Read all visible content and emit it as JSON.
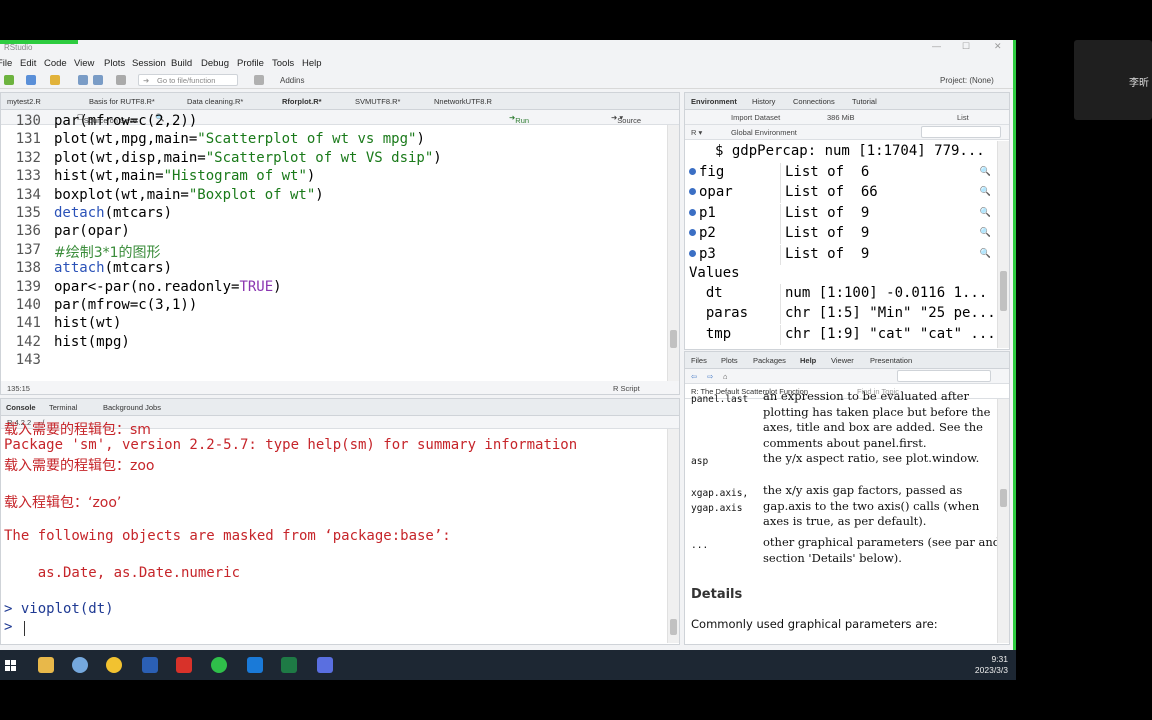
{
  "window": {
    "title": "RStudio"
  },
  "participant": {
    "name": "李昕"
  },
  "menu": [
    "File",
    "Edit",
    "Code",
    "View",
    "Plots",
    "Session",
    "Build",
    "Debug",
    "Profile",
    "Tools",
    "Help"
  ],
  "toolbar": {
    "goto_placeholder": "Go to file/function",
    "addins": "Addins",
    "project": "Project: (None)"
  },
  "editor": {
    "tabs": [
      "mytest2.R",
      "Basis for RUTF8.R*",
      "Data cleaning.R*",
      "Rforplot.R*",
      "SVMUTF8.R*",
      "NnetworkUTF8.R"
    ],
    "source_on_save": "Source on Save",
    "run": "Run",
    "source": "Source",
    "lines": [
      {
        "n": "130",
        "code": "par(mfrow=c(2,2))"
      },
      {
        "n": "131",
        "code": "plot(wt,mpg,main=\"Scatterplot of wt vs mpg\")"
      },
      {
        "n": "132",
        "code": "plot(wt,disp,main=\"Scatterplot of wt VS dsip\")"
      },
      {
        "n": "133",
        "code": "hist(wt,main=\"Histogram of wt\")"
      },
      {
        "n": "134",
        "code": "boxplot(wt,main=\"Boxplot of wt\")"
      },
      {
        "n": "135",
        "code": "detach(mtcars)"
      },
      {
        "n": "136",
        "code": "par(opar)"
      },
      {
        "n": "137",
        "code": "#绘制3*1的图形"
      },
      {
        "n": "138",
        "code": "attach(mtcars)"
      },
      {
        "n": "139",
        "code": "opar<-par(no.readonly=TRUE)"
      },
      {
        "n": "140",
        "code": "par(mfrow=c(3,1))"
      },
      {
        "n": "141",
        "code": "hist(wt)"
      },
      {
        "n": "142",
        "code": "hist(mpg)"
      },
      {
        "n": "143",
        "code": ""
      }
    ],
    "status_pos": "135:15",
    "status_lang": "R Script"
  },
  "console": {
    "tabs": [
      "Console",
      "Terminal",
      "Background Jobs"
    ],
    "version": "R 4.2.2 · ~/",
    "lines": [
      {
        "text": "载入需要的程辑包：sm",
        "cls": "red cjk"
      },
      {
        "text": "Package 'sm', version 2.2-5.7: type help(sm) for summary information",
        "cls": "red"
      },
      {
        "text": "载入需要的程辑包：zoo",
        "cls": "red cjk"
      },
      {
        "text": "",
        "cls": "red"
      },
      {
        "text": "载入程辑包：‘zoo’",
        "cls": "red cjk"
      },
      {
        "text": "",
        "cls": "red"
      },
      {
        "text": "The following objects are masked from ‘package:base’:",
        "cls": "red"
      },
      {
        "text": "",
        "cls": "red"
      },
      {
        "text": "    as.Date, as.Date.numeric",
        "cls": "red"
      },
      {
        "text": "",
        "cls": "red"
      },
      {
        "text": "> vioplot(dt)",
        "cls": "blue"
      },
      {
        "text": "> ",
        "cls": "blue"
      }
    ]
  },
  "environment": {
    "tabs": [
      "Environment",
      "History",
      "Connections",
      "Tutorial"
    ],
    "import_dataset": "Import Dataset",
    "memory": "386 MiB",
    "list_view": "List",
    "global_env": "Global Environment",
    "top_row": "$ gdpPercap: num [1:1704] 779...",
    "data_rows": [
      {
        "name": "fig",
        "value": "List of  6"
      },
      {
        "name": "opar",
        "value": "List of  66"
      },
      {
        "name": "p1",
        "value": "List of  9"
      },
      {
        "name": "p2",
        "value": "List of  9"
      },
      {
        "name": "p3",
        "value": "List of  9"
      }
    ],
    "values_header": "Values",
    "value_rows": [
      {
        "name": "dt",
        "value": "num [1:100] -0.0116 1..."
      },
      {
        "name": "paras",
        "value": "chr [1:5] \"Min\" \"25 pe..."
      },
      {
        "name": "tmp",
        "value": "chr [1:9] \"cat\" \"cat\" ..."
      }
    ]
  },
  "help": {
    "tabs": [
      "Files",
      "Plots",
      "Packages",
      "Help",
      "Viewer",
      "Presentation"
    ],
    "topic": "R: The Default Scatterplot Function",
    "find_placeholder": "Find in Topic",
    "rows": [
      {
        "term": "panel.last",
        "desc": [
          "an expression to be evaluated after",
          "plotting has taken place but before the",
          "axes, title and box are added. See the",
          "comments about panel.first."
        ]
      },
      {
        "term": "asp",
        "desc": [
          "the y/x aspect ratio, see plot.window."
        ]
      },
      {
        "term": "xgap.axis, ygap.axis",
        "desc": [
          "the x/y axis gap factors, passed as",
          "gap.axis to the two axis() calls (when",
          "axes is true, as per default)."
        ]
      },
      {
        "term": "...",
        "desc": [
          "other graphical parameters (see par and",
          "section  'Details'  below)."
        ]
      }
    ],
    "details_heading": "Details",
    "details_text": "Commonly used graphical parameters are:"
  },
  "clock": {
    "time": "9:31",
    "date": "2023/3/3"
  }
}
